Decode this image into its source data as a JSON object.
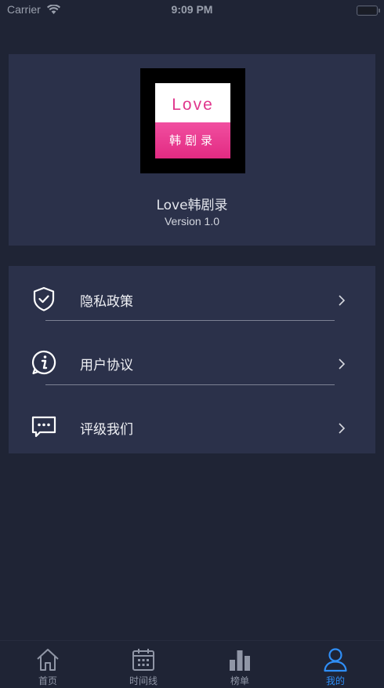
{
  "status_bar": {
    "carrier": "Carrier",
    "time": "9:09 PM"
  },
  "profile": {
    "logo_top_text": "Love",
    "logo_bottom_text": "韩剧录",
    "app_name": "Love韩剧录",
    "version": "Version 1.0"
  },
  "menu": {
    "items": [
      {
        "label": "隐私政策",
        "icon": "shield-check-icon"
      },
      {
        "label": "用户协议",
        "icon": "info-icon"
      },
      {
        "label": "评级我们",
        "icon": "chat-icon"
      }
    ]
  },
  "tab_bar": {
    "tabs": [
      {
        "label": "首页",
        "icon": "home-icon"
      },
      {
        "label": "时间线",
        "icon": "calendar-icon"
      },
      {
        "label": "榜单",
        "icon": "bar-chart-icon"
      },
      {
        "label": "我的",
        "icon": "user-icon",
        "active": true
      }
    ]
  },
  "colors": {
    "background": "#1f2435",
    "card": "#2b314a",
    "accent": "#2f8ef6",
    "logo_pink": "#e0368c"
  }
}
